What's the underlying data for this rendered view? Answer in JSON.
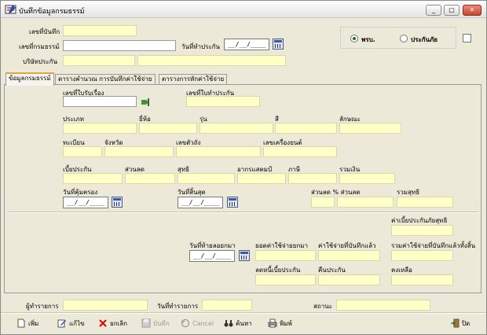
{
  "window": {
    "title": "บันทึกข้อมูลกรมธรรม์",
    "min_label": "_",
    "max_label": "▢",
    "close_label": "✕"
  },
  "header": {
    "record_no_label": "เลขที่บันทึก",
    "policy_no_label": "เลขที่กรมธรรม์",
    "doc_date_label": "วันที่ทำประกัน",
    "doc_date_value": "__/__/____",
    "company_label": "บริษัทประกัน",
    "opt_prb_label": "พรบ.",
    "opt_ins_label": "ประกันภัย"
  },
  "tabs": [
    {
      "label": "ข้อมูลกรมธรรม์"
    },
    {
      "label": "ตารางคำนวณ การบันทึกค่าใช้จ่าย"
    },
    {
      "label": "ตารางการหักค่าใช้จ่าย"
    }
  ],
  "form": {
    "claim_no": "เลขที่ใบรับเรื่อง",
    "insure_no": "เลขที่ใบทำประกัน",
    "type": "ประเภท",
    "brand": "ยี่ห้อ",
    "model": "รุ่น",
    "color": "สี",
    "body": "ลักษณะ",
    "reg": "ทะเบียน",
    "province": "จังหวัด",
    "chassis": "เลขตัวถัง",
    "engine": "เลขเครื่องยนต์",
    "premium": "เบี้ยประกัน",
    "discount": "ส่วนลด",
    "net": "สุทธิ",
    "stamp": "อากรแสตมป์",
    "tax": "ภาษี",
    "total": "รวมเงิน",
    "cover_date": "วันที่คุ้มครอง",
    "cover_date_value": "__/__/____",
    "end_date": "วันที่สิ้นสุด",
    "end_date_value": "__/__/____",
    "disc_pct": "ส่วนลด % ส่วนลด",
    "net_total": "รวมสุทธิ",
    "net_premium": "ค่าเบี้ยประกันภัยสุทธิ",
    "last_date": "วันที่ท้ายลอยกมา",
    "last_date_value": "__/__/____",
    "carry_cost": "ยอดค่าใช้จ่ายยกมา",
    "saved_cost": "ค่าใช้จ่ายที่บันทึกแล้ว",
    "all_cost": "รวมค่าใช้จ่ายที่บันทึกแล้วทั้งสิ้น",
    "reduce_premium": "ลดหนี้เบี้ยประกัน",
    "return_ins": "คืนประกัน",
    "remain": "คงเหลือ"
  },
  "footer": {
    "reporter": "ผู้ทำรายการ",
    "record_date": "วันที่ทำรายการ",
    "status": "สถานะ"
  },
  "toolbar": {
    "add": "เพิ่ม",
    "edit": "แก้ไข",
    "cancel_doc": "ยกเลิก",
    "save": "บันทึก",
    "cancel": "Cancel",
    "search": "ค้นหา",
    "print": "พิมพ์",
    "close": "ปิด"
  },
  "colors": {
    "field": "#ffffc8",
    "accent": "#e8a33a",
    "close_btn": "#c8452c"
  }
}
